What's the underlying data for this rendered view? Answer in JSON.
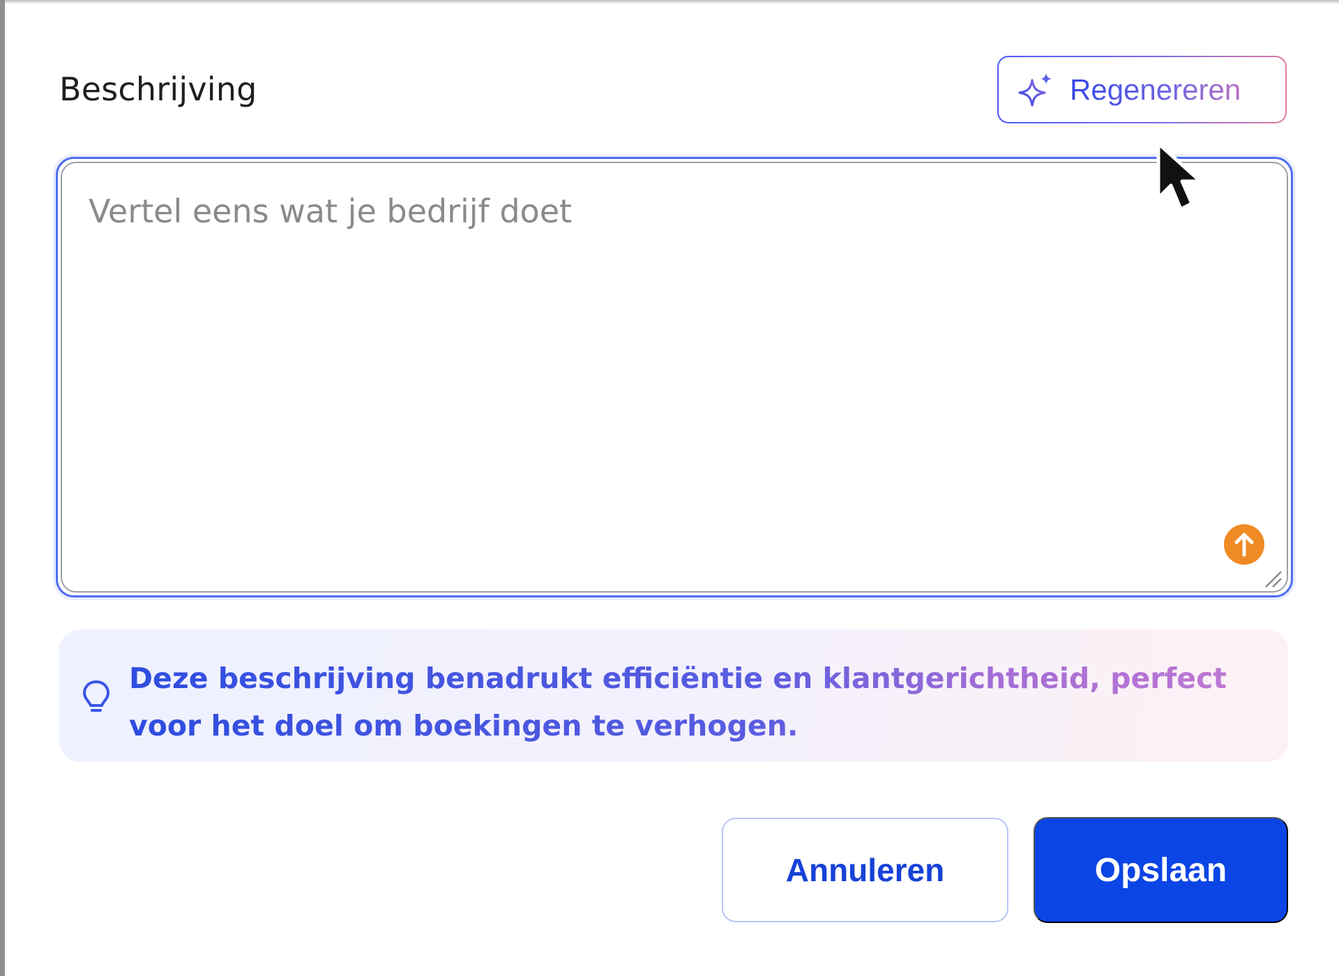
{
  "section": {
    "title": "Beschrijving"
  },
  "regenerate": {
    "label": "Regenereren",
    "icon": "sparkle-icon"
  },
  "description": {
    "value": "",
    "placeholder": "Vertel eens wat je bedrijf doet",
    "upload_icon": "upload-arrow-icon"
  },
  "hint": {
    "icon": "lightbulb-icon",
    "text": "Deze beschrijving benadrukt efficiëntie en klantgerichtheid, perfect voor het doel om boekingen te verhogen."
  },
  "actions": {
    "cancel_label": "Annuleren",
    "save_label": "Opslaan"
  },
  "colors": {
    "primary": "#0b45e6",
    "accent_gradient_start": "#3548e6",
    "accent_gradient_end": "#e07aa0",
    "upload_badge": "#f08a24"
  }
}
